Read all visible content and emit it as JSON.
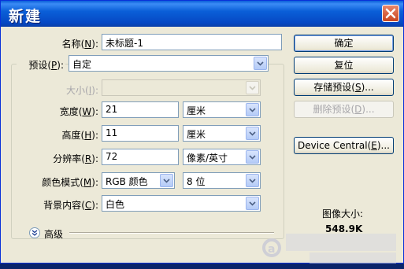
{
  "titlebar": {
    "title": "新建"
  },
  "name": {
    "label": "名称",
    "key": "N",
    "value": "未标题-1"
  },
  "preset": {
    "label": "预设",
    "key": "P",
    "value": "自定"
  },
  "size": {
    "label": "大小",
    "key": "I",
    "value": ""
  },
  "width": {
    "label": "宽度",
    "key": "W",
    "value": "21",
    "unit": "厘米"
  },
  "height": {
    "label": "高度",
    "key": "H",
    "value": "11",
    "unit": "厘米"
  },
  "resolution": {
    "label": "分辨率",
    "key": "R",
    "value": "72",
    "unit": "像素/英寸"
  },
  "color_mode": {
    "label": "颜色模式",
    "key": "M",
    "mode": "RGB 颜色",
    "depth": "8 位"
  },
  "background": {
    "label": "背景内容",
    "key": "C",
    "value": "白色"
  },
  "advanced": {
    "label": "高级"
  },
  "buttons": {
    "ok": "确定",
    "reset": "复位",
    "save_preset_pre": "存储预设(",
    "save_preset_key": "S",
    "save_preset_post": ")...",
    "delete_preset_pre": "删除预设(",
    "delete_preset_key": "D",
    "delete_preset_post": ")...",
    "device_central_pre": "Device Central(",
    "device_central_key": "E",
    "device_central_post": ")..."
  },
  "image_size": {
    "label": "图像大小:",
    "value": "548.9K"
  },
  "colors": {
    "titlebar": "#0a5fd8",
    "dialog_bg": "#ece9d8",
    "field_border": "#7f9db9"
  },
  "icons": [
    "close-icon",
    "chevron-down-icon",
    "expand-advanced-icon"
  ]
}
